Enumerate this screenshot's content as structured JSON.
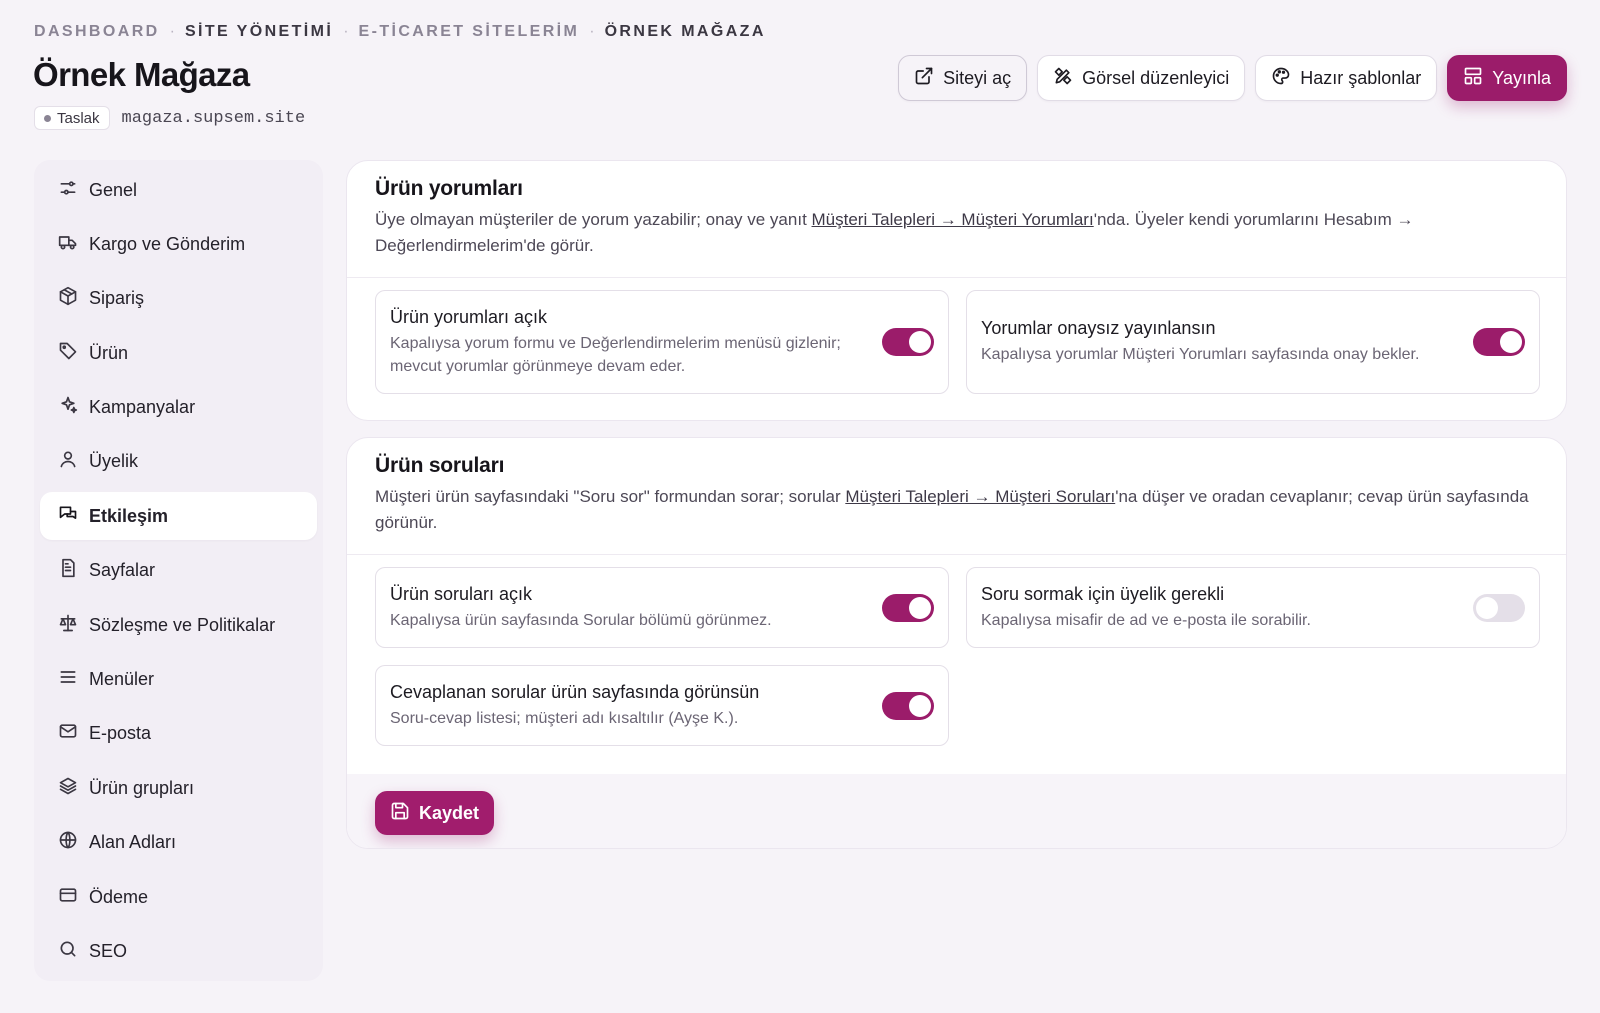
{
  "breadcrumb": {
    "items": [
      "DASHBOARD",
      "SİTE YÖNETİMİ",
      "E-TİCARET SİTELERİM",
      "ÖRNEK MAĞAZA"
    ],
    "separator": "·"
  },
  "page": {
    "title": "Örnek Mağaza",
    "status": "Taslak",
    "domain": "magaza.supsem.site"
  },
  "actions": {
    "open_site": "Siteyi aç",
    "visual_editor": "Görsel düzenleyici",
    "templates": "Hazır şablonlar",
    "publish": "Yayınla"
  },
  "sidebar": {
    "items": [
      {
        "label": "Genel",
        "icon": "sliders-icon"
      },
      {
        "label": "Kargo ve Gönderim",
        "icon": "truck-icon"
      },
      {
        "label": "Sipariş",
        "icon": "package-icon"
      },
      {
        "label": "Ürün",
        "icon": "tag-icon"
      },
      {
        "label": "Kampanyalar",
        "icon": "sparkles-icon"
      },
      {
        "label": "Üyelik",
        "icon": "user-icon"
      },
      {
        "label": "Etkileşim",
        "icon": "chat-icon",
        "active": true
      },
      {
        "label": "Sayfalar",
        "icon": "file-icon"
      },
      {
        "label": "Sözleşme ve Politikalar",
        "icon": "scale-icon"
      },
      {
        "label": "Menüler",
        "icon": "menu-icon"
      },
      {
        "label": "E-posta",
        "icon": "mail-icon"
      },
      {
        "label": "Ürün grupları",
        "icon": "layers-icon"
      },
      {
        "label": "Alan Adları",
        "icon": "globe-icon"
      },
      {
        "label": "Ödeme",
        "icon": "card-icon"
      },
      {
        "label": "SEO",
        "icon": "search-icon"
      }
    ]
  },
  "reviews": {
    "title": "Ürün yorumları",
    "desc_pre": "Üye olmayan müşteriler de yorum yazabilir; onay ve yanıt ",
    "desc_link": "Müşteri Talepleri → Müşteri Yorumları",
    "desc_post": "'nda. Üyeler kendi yorumlarını Hesabım → Değerlendirmelerim'de görür.",
    "options": [
      {
        "title": "Ürün yorumları açık",
        "desc": "Kapalıysa yorum formu ve Değerlendirmelerim menüsü gizlenir; mevcut yorumlar görünmeye devam eder.",
        "on": true
      },
      {
        "title": "Yorumlar onaysız yayınlansın",
        "desc": "Kapalıysa yorumlar Müşteri Yorumları sayfasında onay bekler.",
        "on": true
      }
    ]
  },
  "questions": {
    "title": "Ürün soruları",
    "desc_pre": "Müşteri ürün sayfasındaki \"Soru sor\" formundan sorar; sorular ",
    "desc_link": "Müşteri Talepleri → Müşteri Soruları",
    "desc_post": "'na düşer ve oradan cevaplanır; cevap ürün sayfasında görünür.",
    "options": [
      {
        "title": "Ürün soruları açık",
        "desc": "Kapalıysa ürün sayfasında Sorular bölümü görünmez.",
        "on": true
      },
      {
        "title": "Soru sormak için üyelik gerekli",
        "desc": "Kapalıysa misafir de ad ve e-posta ile sorabilir.",
        "on": false
      },
      {
        "title": "Cevaplanan sorular ürün sayfasında görünsün",
        "desc": "Soru-cevap listesi; müşteri adı kısaltılır (Ayşe K.).",
        "on": true
      }
    ],
    "save_label": "Kaydet"
  },
  "colors": {
    "accent": "#9b1c6a",
    "background": "#f6f3f8"
  }
}
